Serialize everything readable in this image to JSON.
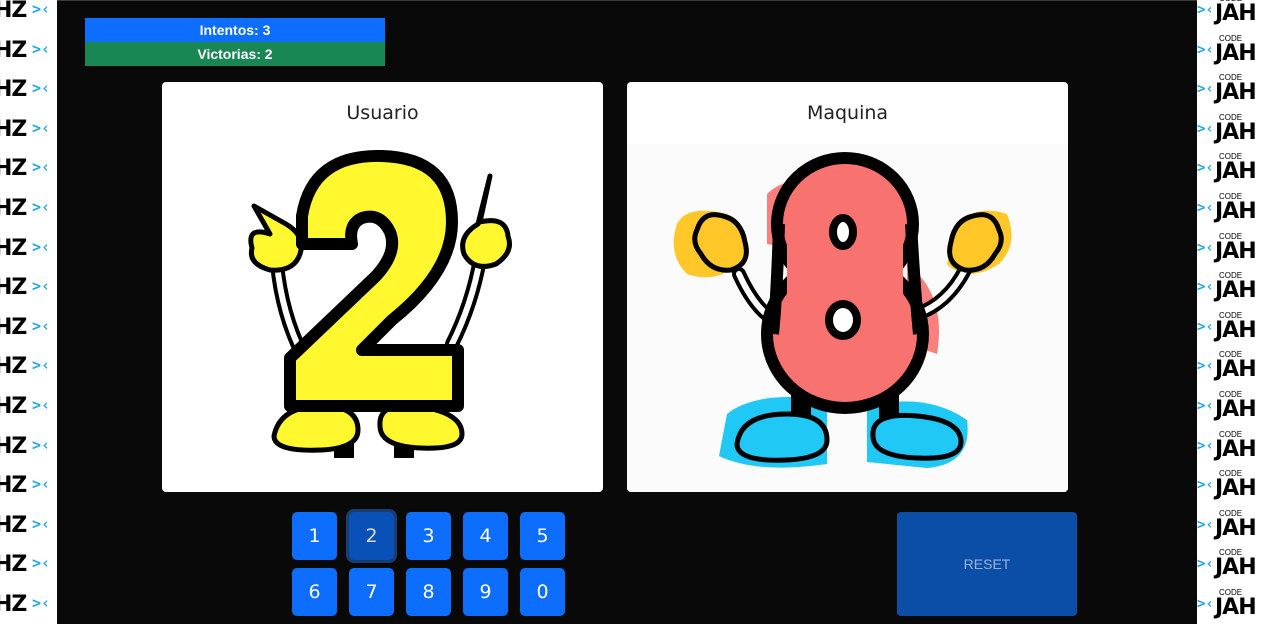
{
  "side_logo": {
    "big": "JAH",
    "small": "CODE",
    "partial": "HZ"
  },
  "stats": {
    "attempts": "Intentos: 3",
    "wins": "Victorias: 2"
  },
  "cards": {
    "user": {
      "title": "Usuario",
      "digit": "2",
      "fill": "#fff82e",
      "shoe": "#fff82e"
    },
    "machine": {
      "title": "Maquina",
      "digit": "8",
      "fill": "#f87270",
      "glove": "#ffc727",
      "shoe": "#1fc8f5"
    }
  },
  "keypad": {
    "keys": [
      "1",
      "2",
      "3",
      "4",
      "5",
      "6",
      "7",
      "8",
      "9",
      "0"
    ],
    "selected": "2"
  },
  "reset_label": "RESET",
  "colors": {
    "primary": "#0d6efd",
    "success": "#198754",
    "background": "#0a0909"
  }
}
